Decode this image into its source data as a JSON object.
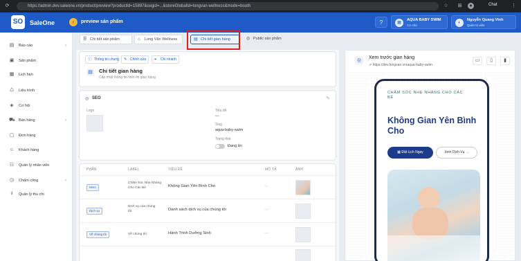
{
  "browser": {
    "url": "https://admin.dev.saleone.vn/product/preview?productId=15897&cegid=...&storeGlobalId=longvan-wellness&mode=booth"
  },
  "app": {
    "logo": "SO",
    "brand": "SaleOne",
    "page_title": "preview sản phẩm"
  },
  "header": {
    "store_name": "AQUA BABY SWIM",
    "store_sub": "Cơ chủ",
    "user_name": "Nguyễn Quang Vinh",
    "user_sub": "Quản trị viên",
    "chat_label": "Chat"
  },
  "sidebar": {
    "items": [
      {
        "label": "Báo cáo",
        "icon": "report-icon",
        "chevron": "›"
      },
      {
        "label": "Sản phẩm",
        "icon": "product-icon",
        "chevron": ""
      },
      {
        "label": "Lịch hẹn",
        "icon": "calendar-icon",
        "chevron": ""
      },
      {
        "label": "Liệu trình",
        "icon": "treatment-icon",
        "chevron": ""
      },
      {
        "label": "Cơ hội",
        "icon": "opportunity-icon",
        "chevron": ""
      },
      {
        "label": "Bán hàng",
        "icon": "sales-icon",
        "chevron": "›"
      },
      {
        "label": "Đơn hàng",
        "icon": "order-icon",
        "chevron": ""
      },
      {
        "label": "Khách hàng",
        "icon": "customer-icon",
        "chevron": ""
      },
      {
        "label": "Quản lý nhân viên",
        "icon": "staff-icon",
        "chevron": ""
      },
      {
        "label": "Chấm công",
        "icon": "timekeeping-icon",
        "chevron": "›"
      },
      {
        "label": "Quản lý thu chi",
        "icon": "finance-icon",
        "chevron": ""
      }
    ]
  },
  "top_tabs": [
    {
      "label": "Chi tiết sản phẩm",
      "icon": "list-icon"
    },
    {
      "label": "Long Vân Wellness",
      "icon": "store-icon"
    },
    {
      "label": "Chi tiết gian hàng",
      "icon": "storefront-icon"
    },
    {
      "label": "Public sản phẩm",
      "icon": "globe-icon"
    }
  ],
  "sub_tabs": [
    {
      "label": "Thông tin chung",
      "icon": "info-icon"
    },
    {
      "label": "Chỉnh sửa",
      "icon": "edit-icon"
    },
    {
      "label": "Chi nhánh",
      "icon": "branch-icon"
    }
  ],
  "section": {
    "title": "Chi tiết gian hàng",
    "subtitle": "Cập nhật thông tin hiển thị gian hàng"
  },
  "seo": {
    "title": "SEO",
    "logo_label": "Logo",
    "title_label": "Tiêu đề",
    "title_value": "—",
    "slug_label": "Slug",
    "slug_value": "aqua-baby-swim",
    "status_label": "Trạng thái",
    "status_value": "Đang ẩn"
  },
  "table": {
    "headers": [
      "PHẦN",
      "LABEL",
      "TIÊU ĐỀ",
      "MÔ TẢ",
      "ẢNH"
    ],
    "rows": [
      {
        "part": "Hero",
        "label": "Chăm Sóc Nhẹ Nhàng Cho Các Bé",
        "title": "Không Gian Yên Bình Cho",
        "desc": "—"
      },
      {
        "part": "Dịch vụ",
        "label": "Dịch vụ của chúng tôi",
        "title": "Danh sách dịch vụ của chúng tôi",
        "desc": "—"
      },
      {
        "part": "Về chúng tôi",
        "label": "Về chúng tôi",
        "title": "Hành Trình Dưỡng Sinh",
        "desc": "—"
      }
    ]
  },
  "preview": {
    "title": "Xem trước gian hàng",
    "url": "https://dev.longvan.vn/aqua-baby-swim",
    "eyebrow": "CHĂM SÓC NHẸ NHÀNG CHO CÁC BÉ",
    "headline": "Không Gian Yên Bình Cho",
    "primary_btn": "Đặt Lịch Ngay",
    "secondary_btn": "Xem Dịch Vụ",
    "secondary_arrow": "→"
  },
  "colors": {
    "primary": "#1e5bc6",
    "highlight": "#e31b1b",
    "navy": "#1f2a44"
  }
}
